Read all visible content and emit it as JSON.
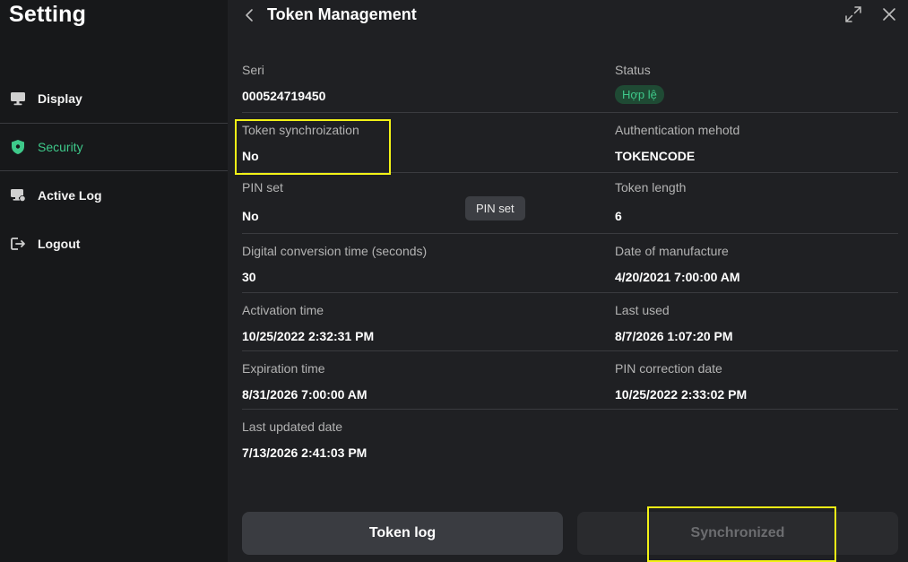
{
  "sidebar": {
    "title": "Setting",
    "items": [
      {
        "label": "Display",
        "icon": "monitor-icon"
      },
      {
        "label": "Security",
        "icon": "shield-icon",
        "active": true
      },
      {
        "label": "Active Log",
        "icon": "log-icon"
      },
      {
        "label": "Logout",
        "icon": "logout-icon"
      }
    ]
  },
  "header": {
    "title": "Token Management"
  },
  "fields": {
    "seri": {
      "label": "Seri",
      "value": "000524719450"
    },
    "status": {
      "label": "Status",
      "value": "Hợp lệ"
    },
    "token_sync": {
      "label": "Token synchroization",
      "value": "No"
    },
    "auth_method": {
      "label": "Authentication mehotd",
      "value": "TOKENCODE"
    },
    "pin_set": {
      "label": "PIN set",
      "value": "No",
      "button": "PIN set"
    },
    "token_length": {
      "label": "Token length",
      "value": "6"
    },
    "digital_conversion": {
      "label": "Digital conversion time (seconds)",
      "value": "30"
    },
    "date_manufacture": {
      "label": "Date of manufacture",
      "value": "4/20/2021 7:00:00 AM"
    },
    "activation_time": {
      "label": "Activation time",
      "value": "10/25/2022 2:32:31 PM"
    },
    "last_used": {
      "label": "Last used",
      "value": "8/7/2026 1:07:20 PM"
    },
    "expiration_time": {
      "label": "Expiration time",
      "value": "8/31/2026 7:00:00 AM"
    },
    "pin_correction": {
      "label": "PIN correction date",
      "value": "10/25/2022 2:33:02 PM"
    },
    "last_updated": {
      "label": "Last updated date",
      "value": "7/13/2026 2:41:03 PM"
    }
  },
  "footer": {
    "token_log": "Token log",
    "synchronized": "Synchronized"
  },
  "colors": {
    "accent": "#3ec98a",
    "highlight": "#f2f216",
    "background": "#1f2023",
    "sidebar": "#17181a"
  }
}
